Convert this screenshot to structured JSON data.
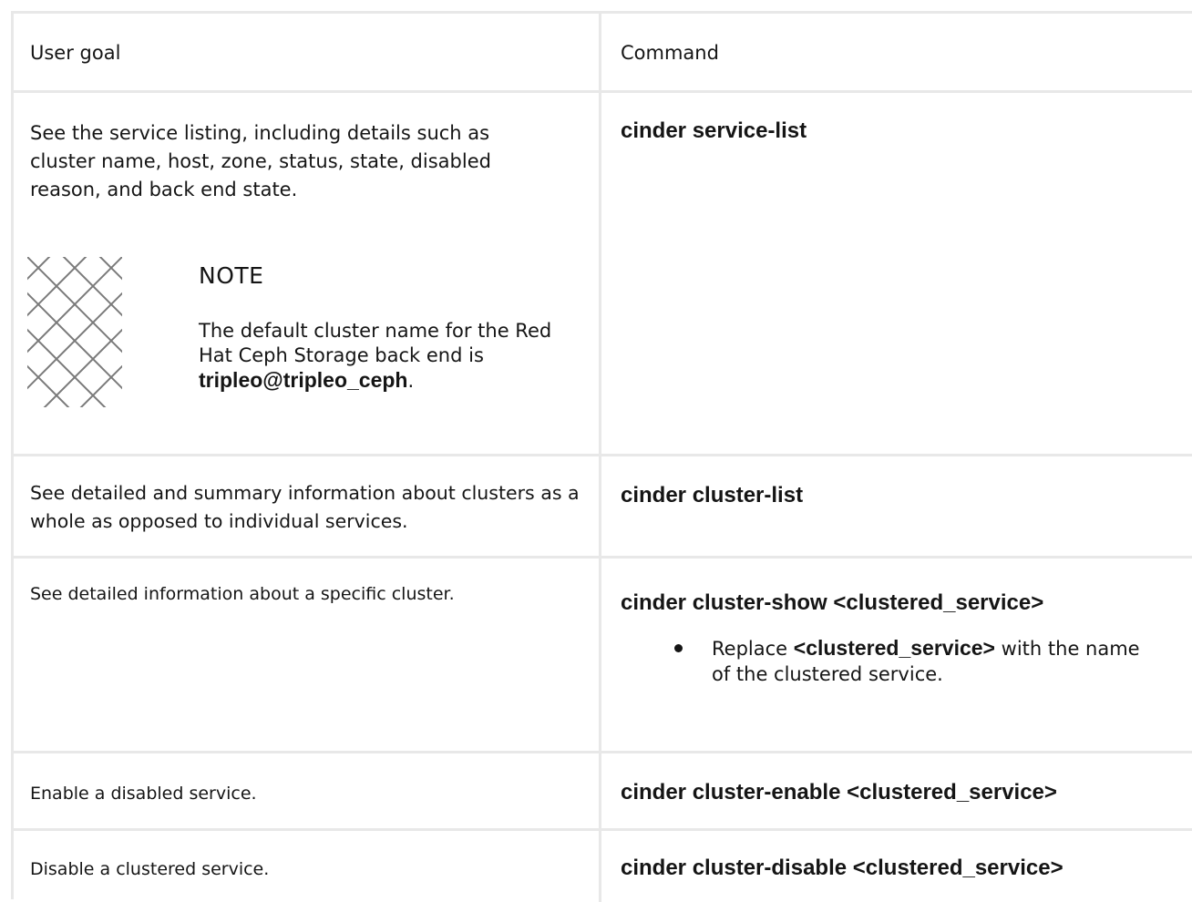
{
  "table": {
    "headers": {
      "goal": "User goal",
      "command": "Command"
    },
    "rows": [
      {
        "goal": "See the service listing, including details such as cluster name, host, zone, status, state, disabled reason, and back end state.",
        "command": "cinder service-list",
        "note": {
          "title": "NOTE",
          "text_before": "The default cluster name for the Red Hat Ceph Storage back end is",
          "code": "tripleo@tripleo_ceph",
          "text_after": "."
        }
      },
      {
        "goal": "See detailed and summary information about clusters as a whole as opposed to individual services.",
        "command": "cinder cluster-list"
      },
      {
        "goal": "See detailed information about a specific cluster.",
        "command": "cinder cluster-show <clustered_service>",
        "bullet": {
          "text_before": "Replace",
          "code": "<clustered_service>",
          "text_after": "with the name of the clustered service."
        }
      },
      {
        "goal": "Enable a disabled service.",
        "command": "cinder cluster-enable <clustered_service>"
      },
      {
        "goal": "Disable a clustered service.",
        "command": "cinder cluster-disable <clustered_service>"
      }
    ]
  },
  "icons": {
    "note": "note-lattice-icon",
    "bullet": "bullet-dot-icon"
  }
}
